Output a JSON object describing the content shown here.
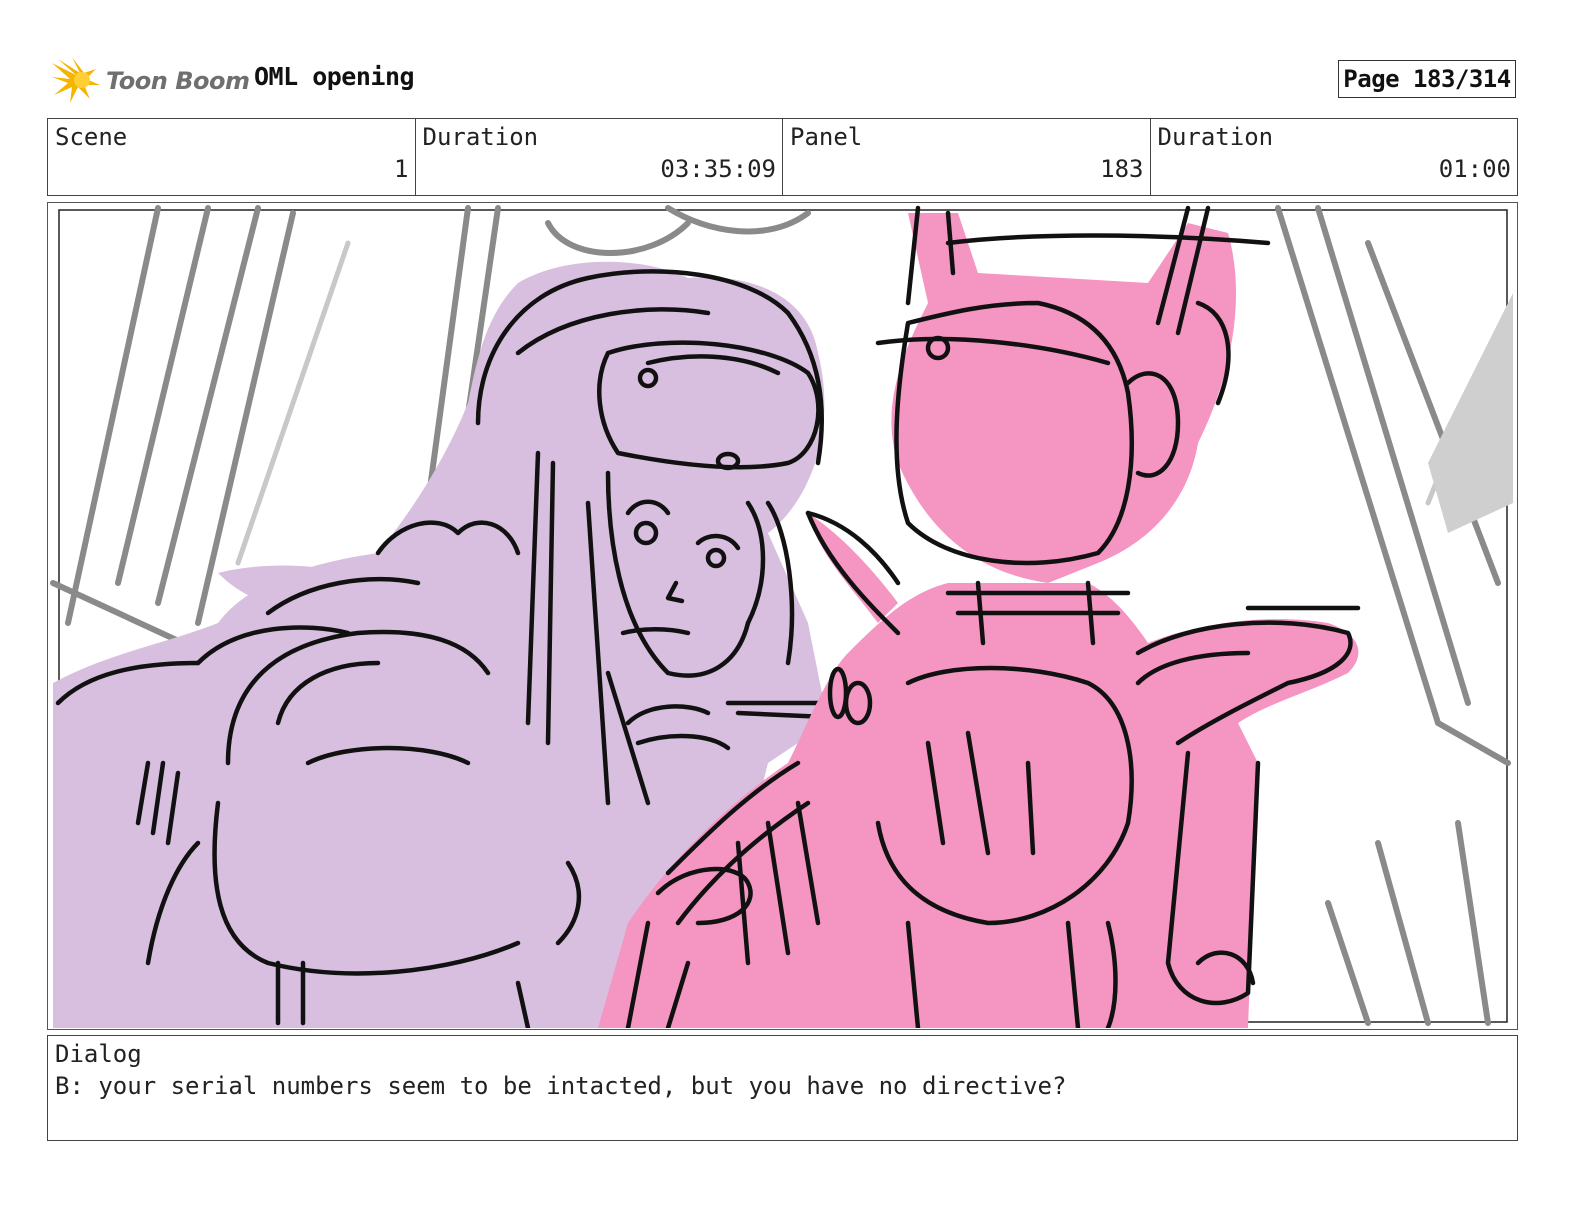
{
  "header": {
    "logo_text": "Toon Boom",
    "project_title": "OML opening",
    "page_label": "Page 183/314"
  },
  "info": [
    {
      "label": "Scene",
      "value": "1"
    },
    {
      "label": "Duration",
      "value": "03:35:09"
    },
    {
      "label": "Panel",
      "value": "183"
    },
    {
      "label": "Duration",
      "value": "01:00"
    }
  ],
  "dialog": {
    "label": "Dialog",
    "text": "B: your serial numbers seem to be intacted, but you have no directive?"
  },
  "colors": {
    "girl_fill": "#d8bfdf",
    "robot_fill": "#f595c2",
    "ink": "#111111",
    "background_lines": "#8a8a8a",
    "logo_star": "#f5b400"
  }
}
